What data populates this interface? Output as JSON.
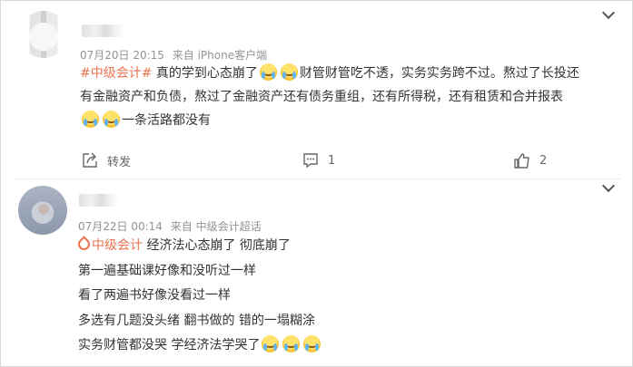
{
  "posts": [
    {
      "meta": {
        "date": "07月20日 20:15",
        "source": "来自 iPhone客户端"
      },
      "content": {
        "topic": "#中级会计#",
        "text_a": "真的学到心态崩了",
        "text_b": "财管财管吃不透，实务实务跨不过。熬过了长投还",
        "line2": "有金融资产和负债，熬过了金融资产还有债务重组，还有所得税，还有租赁和合并报表",
        "line3": "一条活路都没有"
      },
      "actions": {
        "share_label": "转发",
        "comment_count": "1",
        "like_count": "2"
      }
    },
    {
      "meta": {
        "date": "07月22日 00:14",
        "source": "来自 中级会计超话"
      },
      "content": {
        "topic": "中级会计",
        "line1_text": "经济法心态崩了 彻底崩了",
        "line2": "第一遍基础课好像和没听过一样",
        "line3": "看了两遍书好像没看过一样",
        "line4": "多选有几题没头绪 翻书做的 错的一塌糊涂",
        "line5": "实务财管都没哭 学经济法学哭了"
      }
    }
  ],
  "icons": {
    "emoji": "crying-face-icon",
    "share": "share-icon",
    "comment": "comment-icon",
    "like": "thumbs-up-icon",
    "expand": "chevron-down-icon",
    "topic": "super-topic-icon"
  },
  "colors": {
    "accent": "#eb7350",
    "meta": "#939393",
    "text": "#333333"
  }
}
